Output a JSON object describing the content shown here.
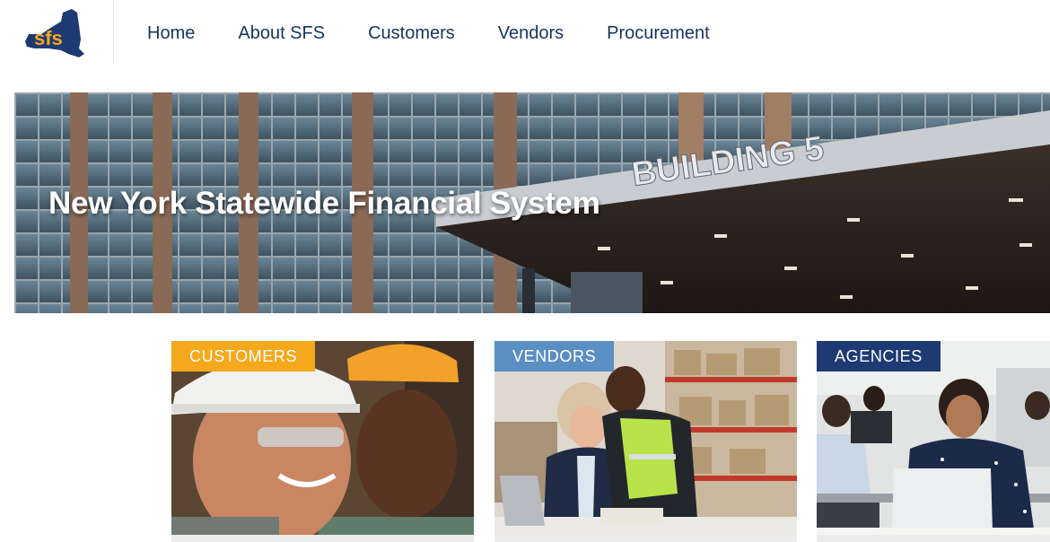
{
  "header": {
    "logo_alt": "SFS logo",
    "logo_text": "sfs",
    "nav": [
      {
        "label": "Home"
      },
      {
        "label": "About SFS"
      },
      {
        "label": "Customers"
      },
      {
        "label": "Vendors"
      },
      {
        "label": "Procurement"
      }
    ]
  },
  "hero": {
    "title": "New York Statewide Financial System",
    "building_sign": "BUILDING 5"
  },
  "cards": [
    {
      "tag": "CUSTOMERS",
      "tag_color": "#f5a81c"
    },
    {
      "tag": "VENDORS",
      "tag_color": "#5b8fc4"
    },
    {
      "tag": "AGENCIES",
      "tag_color": "#1e3a73"
    }
  ],
  "colors": {
    "nav_text": "#15355f",
    "brand_blue": "#1e3a73",
    "brand_gold": "#f5a81c"
  }
}
